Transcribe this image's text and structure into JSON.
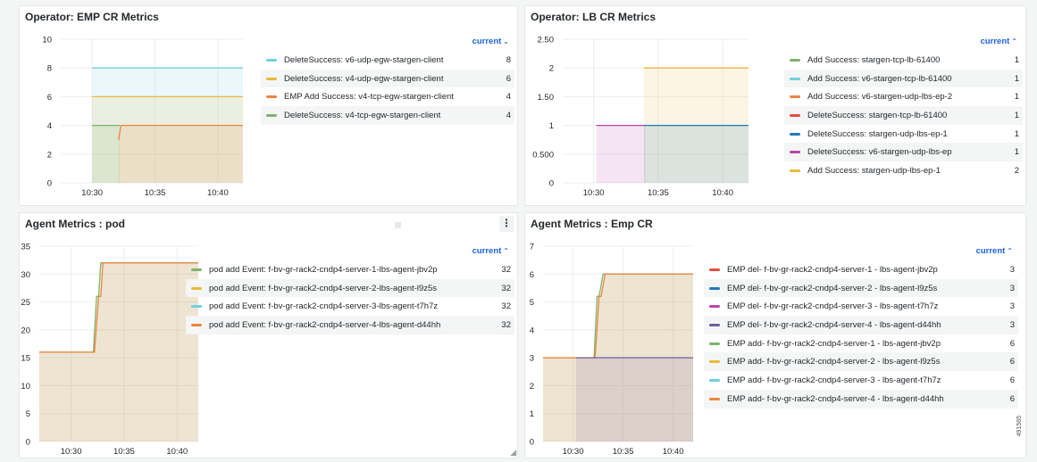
{
  "colors": {
    "green": "#73bf69",
    "yellow": "#f2cc0c",
    "lightblue": "#8ab8ff",
    "cyan": "#6ed0e0",
    "orange": "#e0752d",
    "lightorange": "#ef843c",
    "amber": "#eab839",
    "red": "#e24d42",
    "blue": "#1f78c1",
    "purple": "#ba43a9",
    "violet": "#705da0",
    "link": "#1f62e0"
  },
  "panels": [
    {
      "title": "Operator: EMP CR Metrics",
      "legend_header": "current",
      "legend_arrow": "⌄",
      "legend": [
        {
          "name": "DeleteSuccess: v6-udp-egw-stargen-client",
          "value": "8",
          "color": "#6ed0e0"
        },
        {
          "name": "DeleteSuccess: v4-udp-egw-stargen-client",
          "value": "6",
          "color": "#eab839"
        },
        {
          "name": "EMP Add Success: v4-tcp-egw-stargen-client",
          "value": "4",
          "color": "#ef843c"
        },
        {
          "name": "DeleteSuccess: v4-tcp-egw-stargen-client",
          "value": "4",
          "color": "#7eb26d"
        }
      ]
    },
    {
      "title": "Operator: LB CR Metrics",
      "legend_header": "current",
      "legend_arrow": "⌃",
      "legend": [
        {
          "name": "Add Success: stargen-tcp-lb-61400",
          "value": "1",
          "color": "#7eb26d"
        },
        {
          "name": "Add Success: v6-stargen-tcp-lb-61400",
          "value": "1",
          "color": "#6ed0e0"
        },
        {
          "name": "Add Success: v6-stargen-udp-lbs-ep-2",
          "value": "1",
          "color": "#ef843c"
        },
        {
          "name": "DeleteSuccess: stargen-tcp-lb-61400",
          "value": "1",
          "color": "#e24d42"
        },
        {
          "name": "DeleteSuccess: stargen-udp-lbs-ep-1",
          "value": "1",
          "color": "#1f78c1"
        },
        {
          "name": "DeleteSuccess: v6-stargen-udp-lbs-ep",
          "value": "1",
          "color": "#ba43a9"
        },
        {
          "name": "Add Success: stargen-udp-lbs-ep-1",
          "value": "2",
          "color": "#eab839"
        }
      ]
    },
    {
      "title": "Agent Metrics : pod",
      "menu_glyph": "⋮",
      "legend_header": "current",
      "legend_arrow": "⌃",
      "legend": [
        {
          "name": "pod add Event: f-bv-gr-rack2-cndp4-server-1-lbs-agent-jbv2p",
          "value": "32",
          "color": "#7eb26d"
        },
        {
          "name": "pod add Event: f-bv-gr-rack2-cndp4-server-2-lbs-agent-l9z5s",
          "value": "32",
          "color": "#eab839"
        },
        {
          "name": "pod add Event: f-bv-gr-rack2-cndp4-server-3-lbs-agent-t7h7z",
          "value": "32",
          "color": "#6ed0e0"
        },
        {
          "name": "pod add Event: f-bv-gr-rack2-cndp4-server-4-lbs-agent-d44hh",
          "value": "32",
          "color": "#ef843c"
        }
      ]
    },
    {
      "title": "Agent Metrics : Emp CR",
      "legend_header": "current",
      "legend_arrow": "⌃",
      "side_note": "491565",
      "legend": [
        {
          "name": "EMP del- f-bv-gr-rack2-cndp4-server-1 - lbs-agent-jbv2p",
          "value": "3",
          "color": "#e24d42"
        },
        {
          "name": "EMP del- f-bv-gr-rack2-cndp4-server-2 - lbs-agent-l9z5s",
          "value": "3",
          "color": "#1f78c1"
        },
        {
          "name": "EMP del- f-bv-gr-rack2-cndp4-server-3 - lbs-agent-t7h7z",
          "value": "3",
          "color": "#ba43a9"
        },
        {
          "name": "EMP del- f-bv-gr-rack2-cndp4-server-4 - lbs-agent-d44hh",
          "value": "3",
          "color": "#705da0"
        },
        {
          "name": "EMP add- f-bv-gr-rack2-cndp4-server-1 - lbs-agent-jbv2p",
          "value": "6",
          "color": "#7eb26d"
        },
        {
          "name": "EMP add- f-bv-gr-rack2-cndp4-server-2 - lbs-agent-l9z5s",
          "value": "6",
          "color": "#eab839"
        },
        {
          "name": "EMP add- f-bv-gr-rack2-cndp4-server-3 - lbs-agent-t7h7z",
          "value": "6",
          "color": "#6ed0e0"
        },
        {
          "name": "EMP add- f-bv-gr-rack2-cndp4-server-4 - lbs-agent-d44hh",
          "value": "6",
          "color": "#ef843c"
        }
      ]
    }
  ],
  "chart_data": [
    {
      "type": "area",
      "x_ticks": [
        "10:30",
        "10:35",
        "10:40"
      ],
      "x_tick_values": [
        30,
        35,
        40
      ],
      "xlim": [
        27.5,
        42
      ],
      "y_ticks": [
        "0",
        "2",
        "4",
        "6",
        "8",
        "10"
      ],
      "y_tick_values": [
        0,
        2,
        4,
        6,
        8,
        10
      ],
      "ylim": [
        0,
        10
      ],
      "series": [
        {
          "name": "DeleteSuccess: v6-udp-egw-stargen-client",
          "color": "#6ed0e0",
          "x": [
            30,
            42
          ],
          "y": [
            8,
            8
          ]
        },
        {
          "name": "DeleteSuccess: v4-udp-egw-stargen-client",
          "color": "#eab839",
          "x": [
            30,
            42
          ],
          "y": [
            6,
            6
          ]
        },
        {
          "name": "DeleteSuccess: v4-tcp-egw-stargen-client",
          "color": "#7eb26d",
          "x": [
            30,
            32.2
          ],
          "y": [
            4,
            4
          ]
        },
        {
          "name": "EMP Add Success: v4-tcp-egw-stargen-client",
          "color": "#ef843c",
          "x": [
            32.1,
            32.3,
            42
          ],
          "y": [
            3,
            4,
            4
          ]
        }
      ]
    },
    {
      "type": "area",
      "x_ticks": [
        "10:30",
        "10:35",
        "10:40"
      ],
      "x_tick_values": [
        30,
        35,
        40
      ],
      "xlim": [
        27.6,
        42
      ],
      "y_ticks": [
        "0",
        "0.500",
        "1",
        "1.50",
        "2",
        "2.50"
      ],
      "y_tick_values": [
        0,
        0.5,
        1,
        1.5,
        2,
        2.5
      ],
      "ylim": [
        0,
        2.5
      ],
      "series": [
        {
          "name": "DeleteSuccess: v6-stargen-udp-lbs-ep",
          "color": "#ba43a9",
          "x": [
            30.2,
            34
          ],
          "y": [
            1,
            1
          ]
        },
        {
          "name": "Add Success: stargen-udp-lbs-ep-1",
          "color": "#eab839",
          "x": [
            33.9,
            42
          ],
          "y": [
            2,
            2
          ]
        },
        {
          "name": "DeleteSuccess: stargen-udp-lbs-ep-1",
          "color": "#1f78c1",
          "x": [
            33.9,
            42
          ],
          "y": [
            1,
            1
          ]
        }
      ]
    },
    {
      "type": "area",
      "x_ticks": [
        "10:30",
        "10:35",
        "10:40"
      ],
      "x_tick_values": [
        30,
        35,
        40
      ],
      "xlim": [
        27,
        42
      ],
      "y_ticks": [
        "0",
        "5",
        "10",
        "15",
        "20",
        "25",
        "30",
        "35"
      ],
      "y_tick_values": [
        0,
        5,
        10,
        15,
        20,
        25,
        30,
        35
      ],
      "ylim": [
        0,
        35
      ],
      "series": [
        {
          "name": "pod add Event: f-bv-gr-rack2-cndp4-server-1-lbs-agent-jbv2p",
          "color": "#7eb26d",
          "x": [
            27,
            32.1,
            32.4,
            32.6,
            32.8,
            33,
            42
          ],
          "y": [
            16,
            16,
            26,
            26,
            32,
            32,
            32
          ]
        },
        {
          "name": "pod add Event: f-bv-gr-rack2-cndp4-server-4-lbs-agent-d44hh",
          "color": "#ef843c",
          "x": [
            27,
            32.2,
            32.6,
            32.8,
            33,
            33.2,
            42
          ],
          "y": [
            16,
            16,
            26,
            26,
            32,
            32,
            32
          ]
        }
      ]
    },
    {
      "type": "area",
      "x_ticks": [
        "10:30",
        "10:35",
        "10:40"
      ],
      "x_tick_values": [
        30,
        35,
        40
      ],
      "xlim": [
        27,
        42
      ],
      "y_ticks": [
        "0",
        "1",
        "2",
        "3",
        "4",
        "5",
        "6",
        "7"
      ],
      "y_tick_values": [
        0,
        1,
        2,
        3,
        4,
        5,
        6,
        7
      ],
      "ylim": [
        0,
        7
      ],
      "series": [
        {
          "name": "EMP add- f-bv-gr-rack2-cndp4-server-1 - lbs-agent-jbv2p",
          "color": "#7eb26d",
          "x": [
            27,
            30.3,
            32.1,
            32.4,
            32.6,
            33,
            42
          ],
          "y": [
            3,
            3,
            3,
            5.2,
            5.2,
            6,
            6
          ]
        },
        {
          "name": "EMP add- f-bv-gr-rack2-cndp4-server-4 - lbs-agent-d44hh",
          "color": "#ef843c",
          "x": [
            27,
            30.3,
            32.2,
            32.6,
            32.8,
            33.2,
            42
          ],
          "y": [
            3,
            3,
            3,
            5.2,
            5.2,
            6,
            6
          ]
        },
        {
          "name": "EMP del- f-bv-gr-rack2-cndp4-server-3 - lbs-agent-t7h7z",
          "color": "#705da0",
          "x": [
            30.3,
            42
          ],
          "y": [
            3,
            3
          ]
        }
      ]
    }
  ]
}
